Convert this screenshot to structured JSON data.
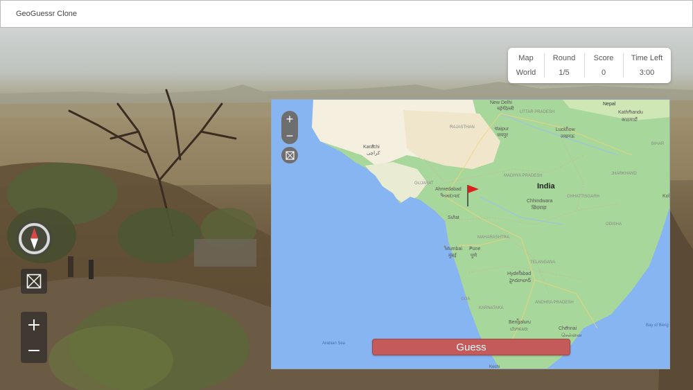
{
  "header": {
    "title": "GeoGuessr Clone"
  },
  "stats": [
    {
      "label": "Map",
      "value": "World"
    },
    {
      "label": "Round",
      "value": "1/5"
    },
    {
      "label": "Score",
      "value": "0"
    },
    {
      "label": "Time Left",
      "value": "3:00"
    }
  ],
  "map": {
    "guess_label": "Guess",
    "zoom_in": "+",
    "zoom_out": "−",
    "labels": {
      "new_delhi": "New Delhi",
      "new_delhi_hi": "नई दिल्ली",
      "uttar_pradesh": "UTTAR PRADESH",
      "nepal": "Nepal",
      "kathmandu": "Kathmandu",
      "kathmandu_hi": "काठमाडौं",
      "rajasthan": "RAJASTHAN",
      "jaipur": "Jaipur",
      "jaipur_hi": "जयपुर",
      "lucknow": "Lucknow",
      "lucknow_hi": "लखनऊ",
      "karachi": "Karachi",
      "karachi_ur": "کراچی",
      "bihar": "BIHAR",
      "gujarat": "GUJARAT",
      "madhya_pradesh": "MADHYA PRADESH",
      "jharkhand": "JHARKHAND",
      "ahmedabad": "Ahmedabad",
      "ahmedabad_gu": "અમદાવાદ",
      "india": "India",
      "chhattisgarh": "CHHATTISGARH",
      "chhindwara": "Chhindwara",
      "chhindwara_hi": "छिंदवाड़ा",
      "kolkata": "Kol",
      "surat": "Surat",
      "odisha": "ODISHA",
      "maharashtra": "MAHARASHTRA",
      "mumbai": "Mumbai",
      "mumbai_mr": "मुंबई",
      "pune": "Pune",
      "pune_mr": "पुणे",
      "telangana": "TELANGANA",
      "hyderabad": "Hyderabad",
      "hyderabad_te": "హైదరాబాద్",
      "goa": "GOA",
      "karnataka": "KARNATAKA",
      "andhra_pradesh": "ANDHRA PRADESH",
      "bengaluru": "Bengaluru",
      "bengaluru_kn": "ಬೆಂಗಳೂರು",
      "chennai": "Chennai",
      "chennai_ta": "சென்னை",
      "arabian_sea": "Arabian Sea",
      "bay_of_bengal": "Bay of Beng",
      "kochi": "Kochi"
    }
  },
  "colors": {
    "guess_button": "#c45a5a",
    "ocean": "#86b5f2",
    "land_green": "#a7d79a",
    "land_tan": "#f5f0e1",
    "flag": "#e02020"
  },
  "icons": {
    "compass": "compass-icon",
    "reset_view": "reset-view-icon",
    "zoom_in": "plus-icon",
    "zoom_out": "minus-icon",
    "guess_marker": "flag-marker-icon"
  }
}
